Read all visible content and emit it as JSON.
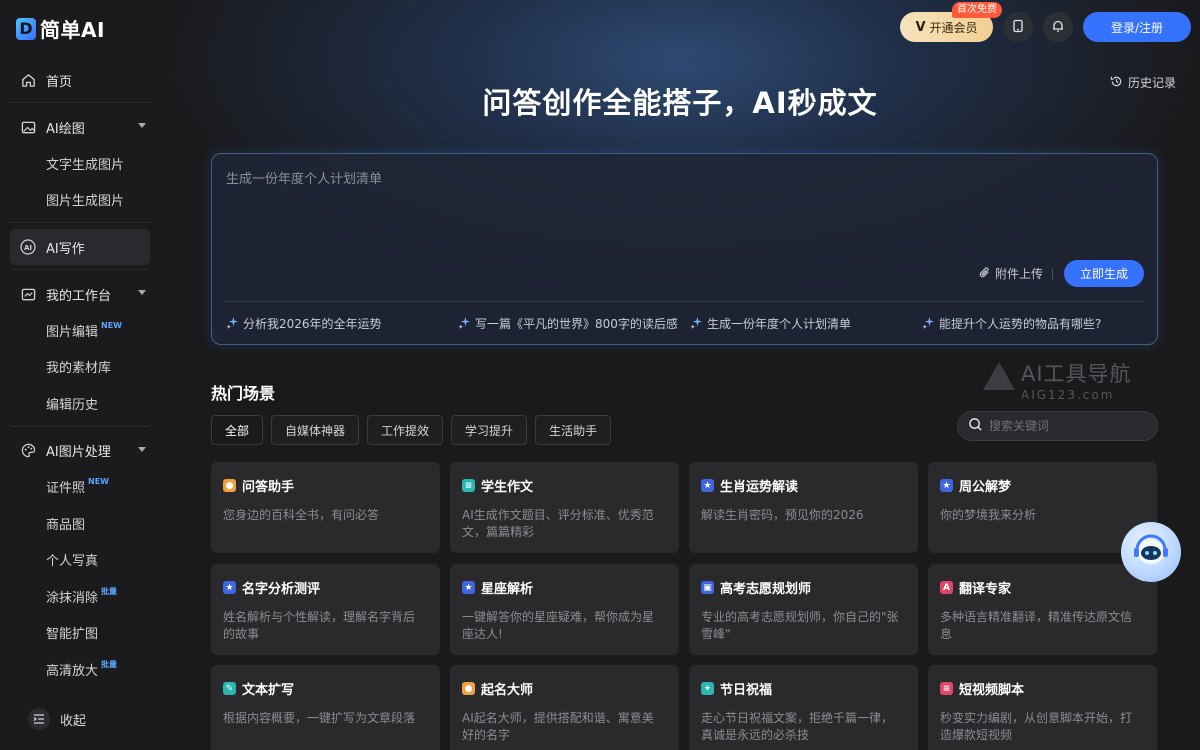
{
  "app": {
    "logo_mark": "D",
    "logo_text": "简单AI"
  },
  "sidebar": {
    "items": [
      {
        "label": "首页",
        "icon": "home-icon"
      },
      {
        "label": "AI绘图",
        "icon": "image-icon"
      },
      {
        "label": "文字生成图片"
      },
      {
        "label": "图片生成图片"
      },
      {
        "label": "AI写作",
        "icon": "ai-icon",
        "active": true
      },
      {
        "label": "我的工作台",
        "icon": "chart-icon"
      },
      {
        "label": "图片编辑",
        "badge": "NEW"
      },
      {
        "label": "我的素材库"
      },
      {
        "label": "编辑历史"
      },
      {
        "label": "AI图片处理",
        "icon": "palette-icon"
      },
      {
        "label": "证件照",
        "badge": "NEW"
      },
      {
        "label": "商品图"
      },
      {
        "label": "个人写真"
      },
      {
        "label": "涂抹消除",
        "badge": "批量"
      },
      {
        "label": "智能扩图"
      },
      {
        "label": "高清放大",
        "badge": "批量"
      }
    ],
    "collapse_label": "收起"
  },
  "header": {
    "vip_label": "开通会员",
    "vip_tag": "首次免费",
    "login_label": "登录/注册",
    "history_label": "历史记录"
  },
  "hero": {
    "title": "问答创作全能搭子，AI秒成文",
    "prompt_placeholder": "生成一份年度个人计划清单",
    "attach_label": "附件上传",
    "generate_label": "立即生成",
    "suggestions": [
      "分析我2026年的全年运势",
      "写一篇《平凡的世界》800字的读后感",
      "生成一份年度个人计划清单",
      "能提升个人运势的物品有哪些?"
    ]
  },
  "hot": {
    "title": "热门场景",
    "watermark_line1": "AI工具导航",
    "watermark_line2": "AIG123.com",
    "filters": [
      "全部",
      "自媒体神器",
      "工作提效",
      "学习提升",
      "生活助手"
    ],
    "search_placeholder": "搜索关键词",
    "cards": [
      {
        "title": "问答助手",
        "desc": "您身边的百科全书，有问必答",
        "icon": "person-icon",
        "color": "#f0a040"
      },
      {
        "title": "学生作文",
        "desc": "AI生成作文题目、评分标准、优秀范文，篇篇精彩",
        "icon": "doc-icon",
        "color": "#2bb6b0"
      },
      {
        "title": "生肖运势解读",
        "desc": "解读生肖密码，预见你的2026",
        "icon": "star-icon",
        "color": "#3f66e0"
      },
      {
        "title": "周公解梦",
        "desc": "你的梦境我来分析",
        "icon": "star-icon",
        "color": "#3f66e0"
      },
      {
        "title": "名字分析测评",
        "desc": "姓名解析与个性解读，理解名字背后的故事",
        "icon": "star-icon",
        "color": "#3f66e0"
      },
      {
        "title": "星座解析",
        "desc": "一键解答你的星座疑难，帮你成为星座达人!",
        "icon": "star-icon",
        "color": "#3f66e0"
      },
      {
        "title": "高考志愿规划师",
        "desc": "专业的高考志愿规划师，你自己的\"张雪峰\"",
        "icon": "person-card-icon",
        "color": "#3f66e0"
      },
      {
        "title": "翻译专家",
        "desc": "多种语言精准翻译，精准传达原文信息",
        "icon": "translate-icon",
        "color": "#e0456a"
      },
      {
        "title": "文本扩写",
        "desc": "根据内容概要，一键扩写为文章段落",
        "icon": "edit-icon",
        "color": "#2bb6b0"
      },
      {
        "title": "起名大师",
        "desc": "AI起名大师，提供搭配和谐、寓意美好的名字",
        "icon": "person-icon",
        "color": "#f0a040"
      },
      {
        "title": "节日祝福",
        "desc": "走心节日祝福文案，拒绝千篇一律，真诚是永远的必杀技",
        "icon": "gift-icon",
        "color": "#2bb6b0"
      },
      {
        "title": "短视频脚本",
        "desc": "秒变实力编剧，从创意脚本开始，打造爆款短视频",
        "icon": "script-icon",
        "color": "#e0456a"
      }
    ]
  }
}
